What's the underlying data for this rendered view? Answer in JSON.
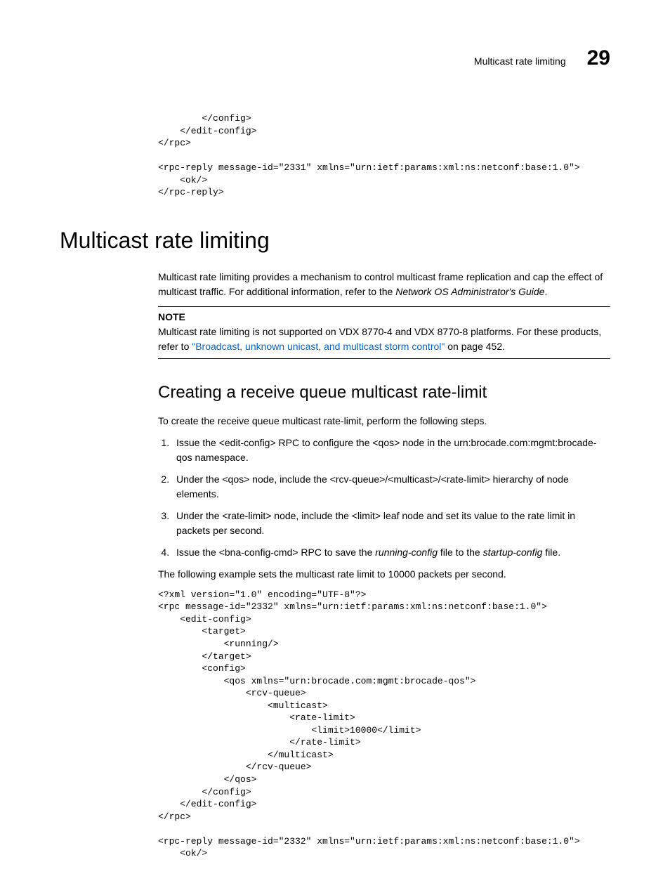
{
  "header": {
    "label": "Multicast rate limiting",
    "chapter": "29"
  },
  "code1": "        </config>\n    </edit-config>\n</rpc>\n\n<rpc-reply message-id=\"2331\" xmlns=\"urn:ietf:params:xml:ns:netconf:base:1.0\">\n    <ok/>\n</rpc-reply>",
  "h1": "Multicast rate limiting",
  "intro": {
    "pre": "Multicast rate limiting provides a mechanism to control multicast frame replication and cap the effect of multicast traffic. For additional information, refer to the ",
    "em": "Network OS Administrator's Guide",
    "post": "."
  },
  "note": {
    "title": "NOTE",
    "pre": "Multicast rate limiting is not supported on VDX 8770-4 and VDX 8770-8 platforms. For these products, refer to ",
    "link": "\"Broadcast, unknown unicast, and multicast storm control\"",
    "post": " on page 452."
  },
  "h2": "Creating a receive queue multicast rate-limit",
  "p2": "To create the receive queue multicast rate-limit, perform the following steps.",
  "steps": {
    "s1": "Issue the <edit-config> RPC to configure the <qos> node in the urn:brocade.com:mgmt:brocade-qos namespace.",
    "s2": "Under the <qos> node, include the <rcv-queue>/<multicast>/<rate-limit> hierarchy of node elements.",
    "s3": "Under the <rate-limit> node, include the <limit> leaf node and set its value to the rate limit in packets per second.",
    "s4_pre": "Issue the <bna-config-cmd> RPC to save the ",
    "s4_em1": "running-config",
    "s4_mid": " file to the ",
    "s4_em2": "startup-config",
    "s4_post": " file."
  },
  "p3": "The following example sets the multicast rate limit to 10000 packets per second.",
  "code2": "<?xml version=\"1.0\" encoding=\"UTF-8\"?>\n<rpc message-id=\"2332\" xmlns=\"urn:ietf:params:xml:ns:netconf:base:1.0\">\n    <edit-config>\n        <target>\n            <running/>\n        </target>\n        <config>\n            <qos xmlns=\"urn:brocade.com:mgmt:brocade-qos\">\n                <rcv-queue>\n                    <multicast>\n                        <rate-limit>\n                            <limit>10000</limit>\n                        </rate-limit>\n                    </multicast>\n                </rcv-queue>\n            </qos>\n        </config>\n    </edit-config>\n</rpc>\n\n<rpc-reply message-id=\"2332\" xmlns=\"urn:ietf:params:xml:ns:netconf:base:1.0\">\n    <ok/>"
}
